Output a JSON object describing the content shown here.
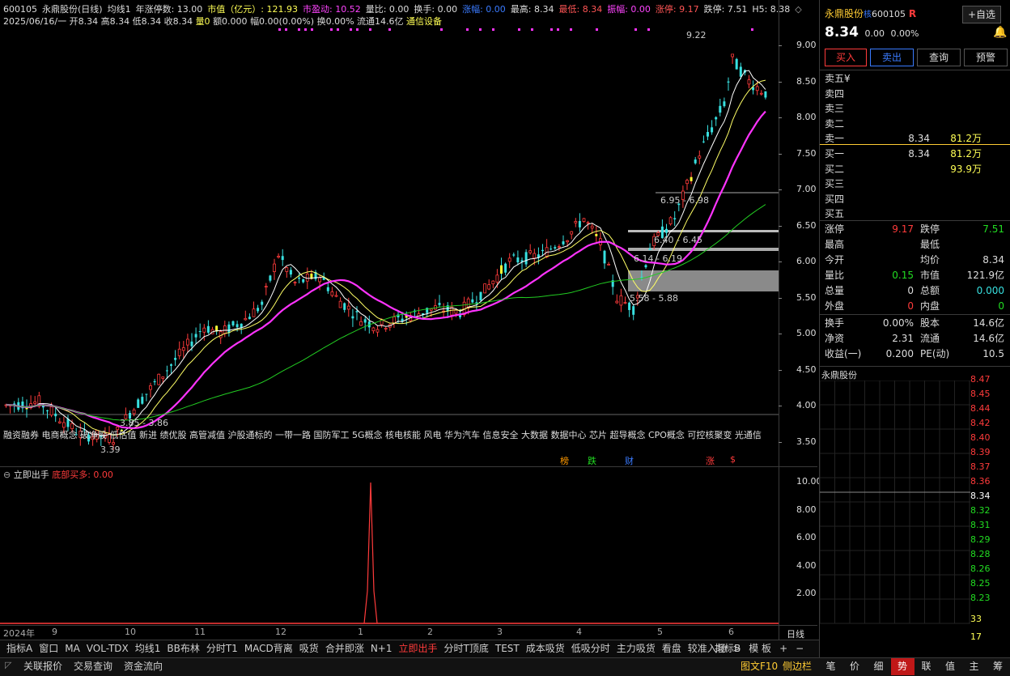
{
  "header": {
    "code": "600105",
    "name_mode": "永鼎股份(日线)",
    "ma_label": "均线1",
    "limit_days": "年涨停数: 13.00",
    "mktcap": "市值（亿元）: 121.93",
    "pe": "市盈动: 10.52",
    "vol_ratio": "量比: 0.00",
    "turnover": "换手: 0.00",
    "change": "涨幅: 0.00",
    "high": "最高: 8.34",
    "low": "最低: 8.34",
    "amplitude": "振幅: 0.00",
    "limit_up": "涨停: 9.17",
    "limit_down": "跌停: 7.51",
    "h5": "H5: 8.38"
  },
  "header2": {
    "date_info": "2025/06/16/一 开8.34 高8.34 低8.34 收8.34",
    "vol": "量0",
    "amt": "额0.000",
    "amp": "幅0.00(0.00%)",
    "turn": "换0.00%",
    "float": "流通14.6亿",
    "sector": "通信设备"
  },
  "price_axis": [
    "9.00",
    "8.50",
    "8.00",
    "7.50",
    "7.00",
    "6.50",
    "6.00",
    "5.50",
    "5.00",
    "4.50",
    "4.00",
    "3.50"
  ],
  "indicator_axis": [
    "10.00",
    "8.00",
    "6.00",
    "4.00",
    "2.00"
  ],
  "annotations": {
    "high_mark": "9.22",
    "low_mark": "3.39",
    "zone1": "6.95 - 6.98",
    "zone2": "6.40 - 6.45",
    "zone3": "6.14 - 6.19",
    "zone4": "5.58 - 5.88",
    "zone5": "3.85 - 3.86"
  },
  "concepts": "融资融券 电商概念 破净股 低估值 新进 绩优股 高管减值 沪股通标的 一带一路 国防军工 5G概念 核电核能 风电 华为汽车 信息安全 大数据 数据中心 芯片 超导概念 CPO概念 可控核聚变 光通信",
  "markers": {
    "bang": "榜",
    "die": "跌",
    "cai": "财",
    "zhang": "涨",
    "dollar": "$"
  },
  "indicator_panel": {
    "name": "立即出手",
    "value_label": "底部买多: 0.00"
  },
  "x_axis": [
    "2024年",
    "9",
    "10",
    "11",
    "12",
    "1",
    "2",
    "3",
    "4",
    "5",
    "6"
  ],
  "x_axis_right": "日线",
  "bottom_tabs": [
    "指标A",
    "窗口",
    "MA",
    "VOL-TDX",
    "均线1",
    "BB布林",
    "分时T1",
    "MACD背离",
    "吸货",
    "合并即涨",
    "N+1",
    "立即出手",
    "分时T顶底",
    "TEST",
    "成本吸货",
    "低吸分时",
    "主力吸货",
    "看盘",
    "较准入场",
    ">"
  ],
  "bottom_tabs_right": [
    "指标B",
    "模 板",
    "+",
    "−"
  ],
  "bottom_bar": {
    "left": [
      "关联报价",
      "交易查询",
      "资金流向"
    ],
    "right": [
      "图文F10",
      "侧边栏"
    ]
  },
  "quote": {
    "name": "永鼎股份",
    "name_tag": "核",
    "code": "600105",
    "r_flag": "R",
    "select_btn": "+自选",
    "price": "8.34",
    "change": "0.00",
    "pct": "0.00%",
    "buttons": [
      "买入",
      "卖出",
      "查询",
      "预警"
    ],
    "sell": [
      {
        "label": "卖五¥",
        "price": "",
        "vol": ""
      },
      {
        "label": "卖四",
        "price": "",
        "vol": ""
      },
      {
        "label": "卖三",
        "price": "",
        "vol": ""
      },
      {
        "label": "卖二",
        "price": "",
        "vol": ""
      },
      {
        "label": "卖一",
        "price": "8.34",
        "vol": "81.2万"
      }
    ],
    "buy": [
      {
        "label": "买一",
        "price": "8.34",
        "vol": "81.2万"
      },
      {
        "label": "买二",
        "price": "",
        "vol": "93.9万"
      },
      {
        "label": "买三",
        "price": "",
        "vol": ""
      },
      {
        "label": "买四",
        "price": "",
        "vol": ""
      },
      {
        "label": "买五",
        "price": "",
        "vol": ""
      }
    ],
    "stats": [
      {
        "l1": "涨停",
        "v1": "9.17",
        "l2": "跌停",
        "v2": "7.51"
      },
      {
        "l1": "最高",
        "v1": "",
        "l2": "最低",
        "v2": ""
      },
      {
        "l1": "今开",
        "v1": "",
        "l2": "均价",
        "v2": "8.34"
      },
      {
        "l1": "量比",
        "v1": "0.15",
        "l2": "市值",
        "v2": "121.9亿"
      },
      {
        "l1": "总量",
        "v1": "0",
        "l2": "总额",
        "v2": "0.000"
      },
      {
        "l1": "外盘",
        "v1": "0",
        "l2": "内盘",
        "v2": "0"
      }
    ],
    "stats2": [
      {
        "l1": "换手",
        "v1": "0.00%",
        "l2": "股本",
        "v2": "14.6亿"
      },
      {
        "l1": "净资",
        "v1": "2.31",
        "l2": "流通",
        "v2": "14.6亿"
      },
      {
        "l1": "收益(一)",
        "v1": "0.200",
        "l2": "PE(动)",
        "v2": "10.5"
      }
    ],
    "mini_title": "永鼎股份",
    "ladder": [
      "8.47",
      "8.45",
      "8.44",
      "8.42",
      "8.40",
      "8.39",
      "8.37",
      "8.36",
      "8.34",
      "8.32",
      "8.31",
      "8.29",
      "8.28",
      "8.26",
      "8.25",
      "8.23",
      "33",
      "17"
    ],
    "side_tabs": [
      "笔",
      "价",
      "细",
      "势",
      "联",
      "值",
      "主",
      "筹"
    ]
  },
  "colors": {
    "up": "#ff3b3b",
    "down": "#38e0e0",
    "ma5": "#ffffff",
    "ma10": "#ffff66",
    "ma20": "#ff33ff",
    "ma60": "#22cc22"
  }
}
